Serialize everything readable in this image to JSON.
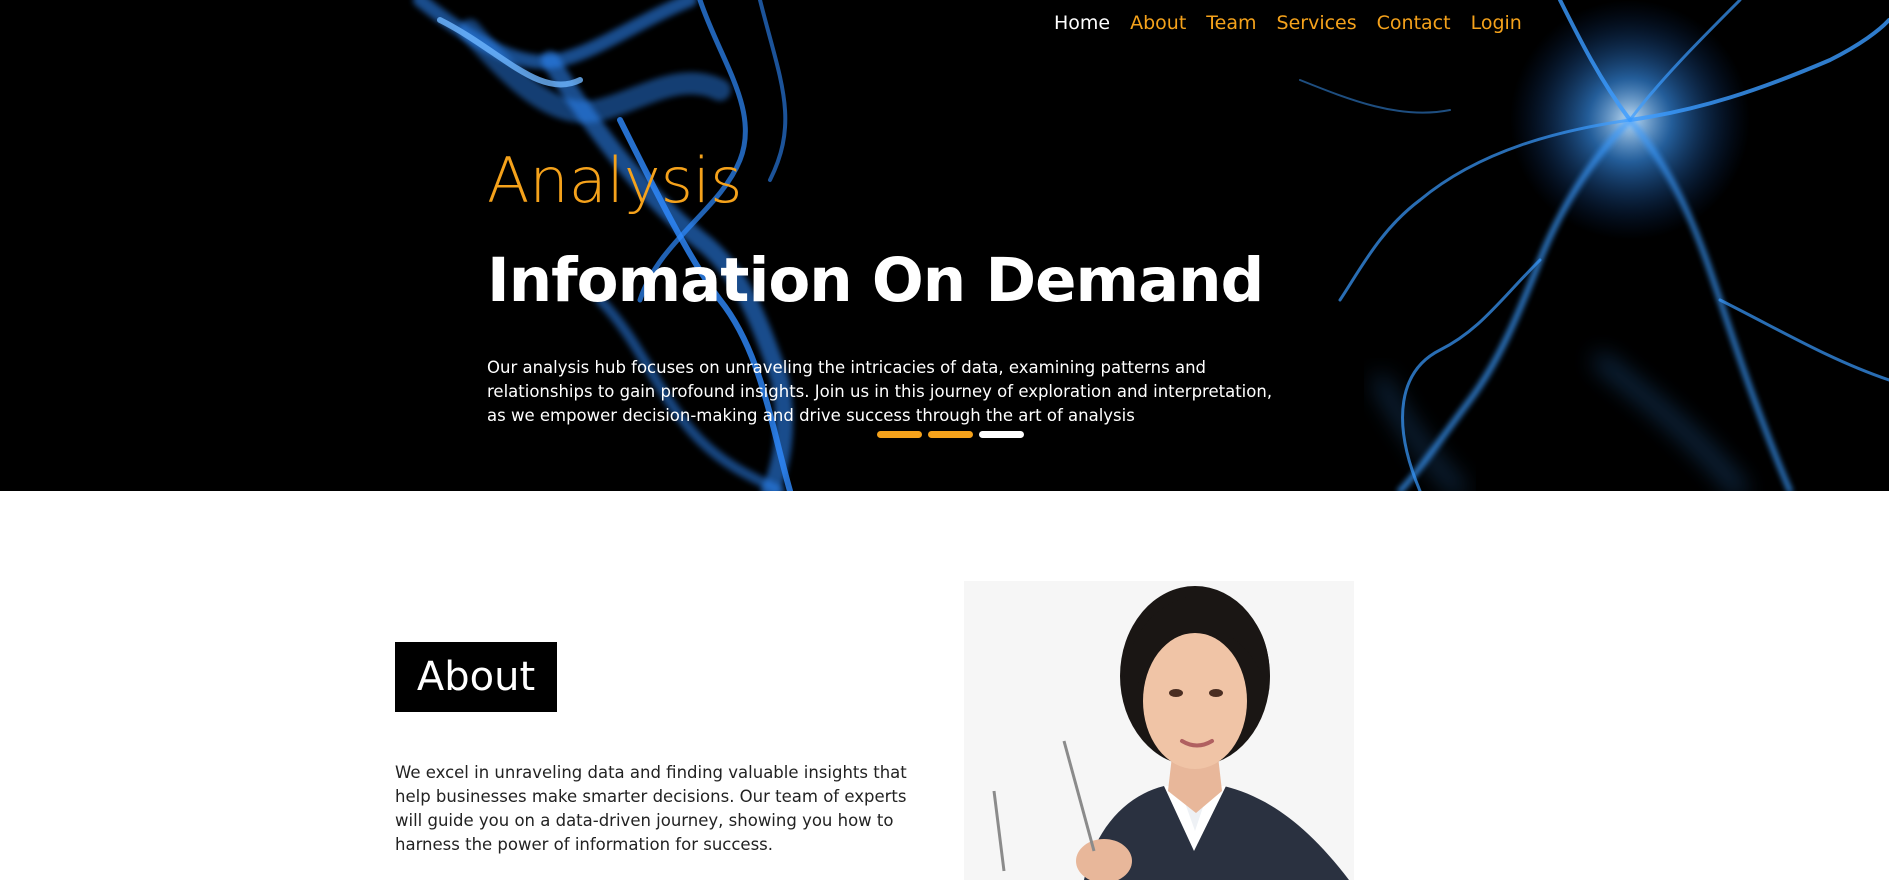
{
  "nav": {
    "items": [
      {
        "label": "Home",
        "active": true
      },
      {
        "label": "About",
        "active": false
      },
      {
        "label": "Team",
        "active": false
      },
      {
        "label": "Services",
        "active": false
      },
      {
        "label": "Contact",
        "active": false
      },
      {
        "label": "Login",
        "active": false
      }
    ]
  },
  "hero": {
    "kicker": "Analysis",
    "title": "Infomation On Demand",
    "description": "Our analysis hub focuses on unraveling the intricacies of data, examining patterns and relationships to gain profound insights. Join us in this journey of exploration and interpretation, as we empower decision-making and drive success through the art of analysis",
    "slides": {
      "count": 3,
      "active_index": 2
    }
  },
  "about": {
    "heading": "About",
    "text": "We excel in unraveling data and finding valuable insights that help businesses make smarter decisions. Our team of experts will guide you on a data-driven journey, showing you how to harness the power of information for success."
  },
  "colors": {
    "accent": "#f5a21b",
    "hero_bg": "#000000",
    "smoke": "#2f8bff",
    "heading_box": "#000000"
  },
  "icons": {
    "hero_background": "blue-smoke-image",
    "about_photo": "businesswoman-photo"
  }
}
